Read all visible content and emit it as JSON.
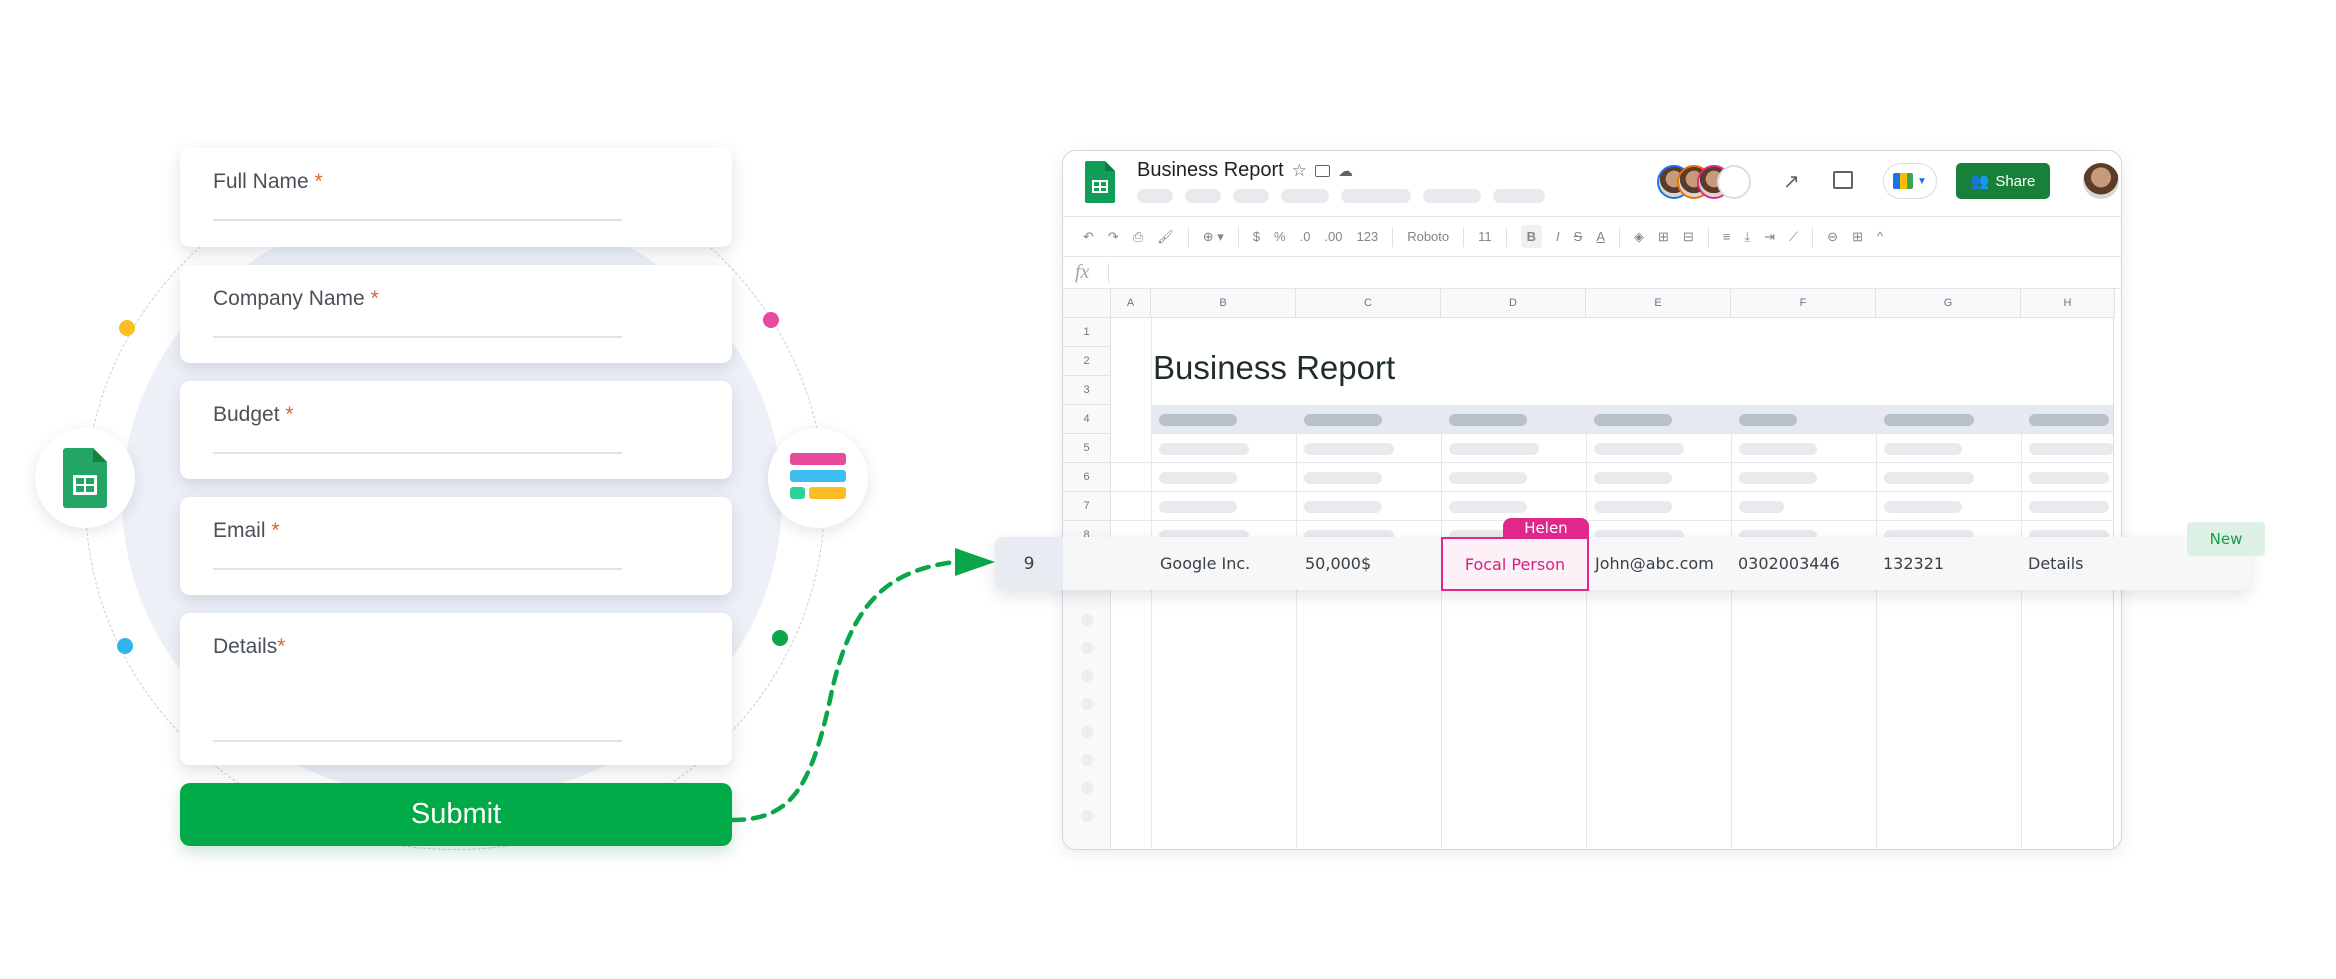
{
  "form": {
    "fields": [
      {
        "label": "Full Name",
        "required_mark": "*"
      },
      {
        "label": "Company Name",
        "required_mark": "*"
      },
      {
        "label": "Budget ",
        "required_mark": "*"
      },
      {
        "label": "Email",
        "required_mark": "*"
      },
      {
        "label": "Details",
        "required_mark": "*"
      }
    ],
    "submit_label": "Submit"
  },
  "icons": {
    "left_badge": "google-sheets-icon",
    "right_badge": "form-builder-icon"
  },
  "colors": {
    "accent_green": "#00aa47",
    "sheets_green": "#188038",
    "collaborator_pink": "#e0288c",
    "dot_yellow": "#fbbc25",
    "dot_pink": "#e8499a",
    "dot_blue": "#2fb4ef",
    "dot_green": "#0aa64a"
  },
  "sheet": {
    "doc_title": "Business Report",
    "toolbar": {
      "zoom_caret": "▾",
      "currency": "$",
      "percent": "%",
      "dec_decrease": ".0",
      "dec_increase": ".00",
      "number_format": "123",
      "font": "Roboto",
      "font_size": "11",
      "bold": "B",
      "italic": "I",
      "strike": "S",
      "text_color": "A"
    },
    "share_label": "Share",
    "formula_bar_label": "fx",
    "columns": [
      "A",
      "B",
      "C",
      "D",
      "E",
      "F",
      "G",
      "H"
    ],
    "rows": [
      "1",
      "2",
      "3",
      "4",
      "5",
      "6",
      "7",
      "8"
    ],
    "title_cell": "Business Report",
    "new_row": {
      "number": "9",
      "cells": [
        "Google Inc.",
        "50,000$",
        "Focal Person",
        "John@abc.com",
        "0302003446",
        "132321",
        "Details"
      ]
    },
    "collaborator_cursor": "Helen",
    "new_badge": "New"
  }
}
